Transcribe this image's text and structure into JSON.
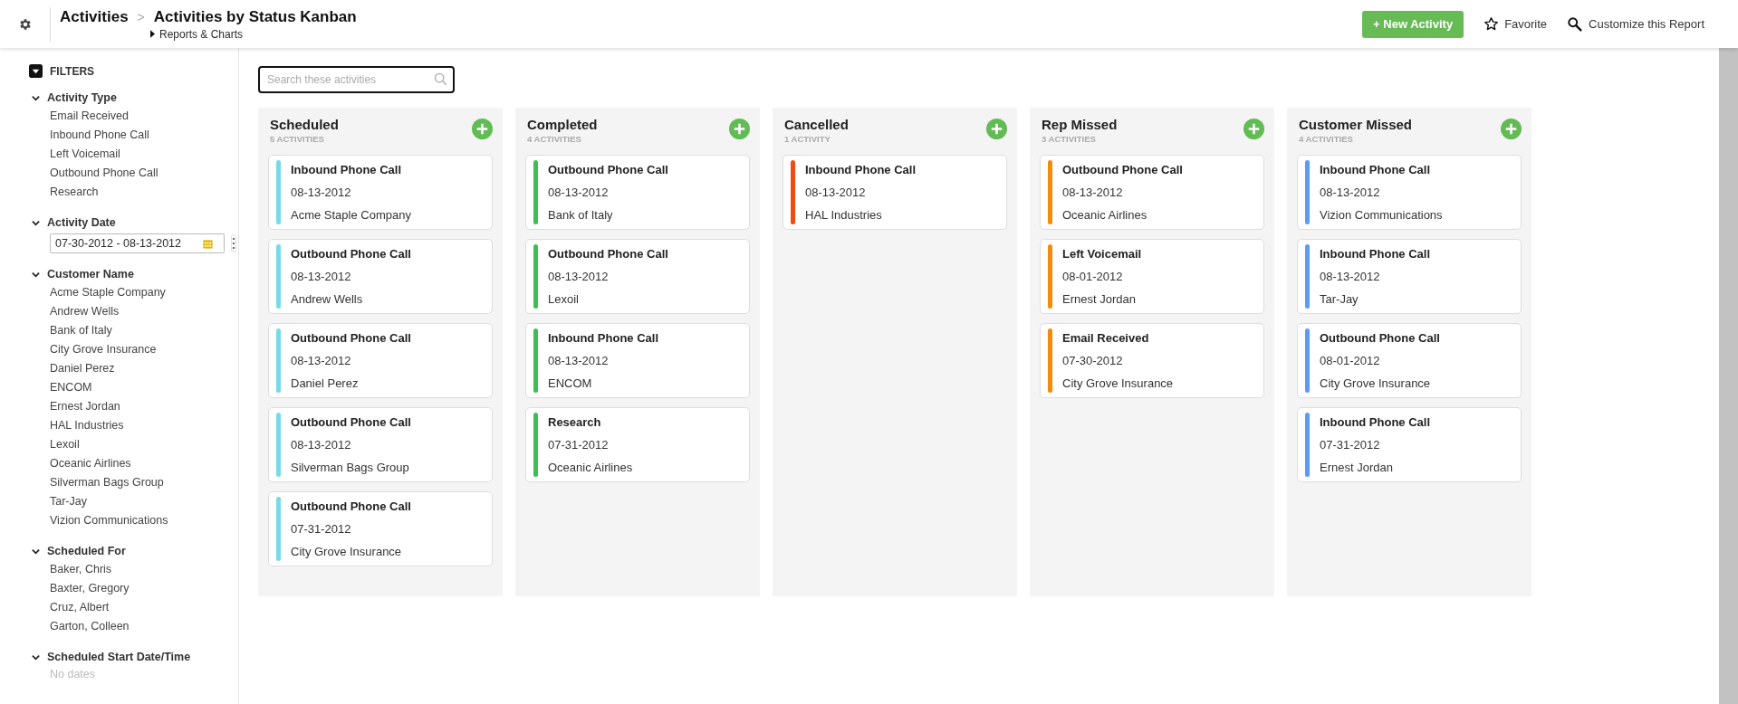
{
  "header": {
    "breadcrumb_root": "Activities",
    "separator": ">",
    "title": "Activities by Status Kanban",
    "subtitle": "Reports & Charts",
    "new_button": "+ New Activity",
    "favorite": "Favorite",
    "customize": "Customize this Report"
  },
  "filters": {
    "title": "FILTERS",
    "sections": [
      {
        "kind": "list",
        "label": "Activity Type",
        "expanded": true,
        "items": [
          "Email Received",
          "Inbound Phone Call",
          "Left Voicemail",
          "Outbound Phone Call",
          "Research"
        ]
      },
      {
        "kind": "daterange",
        "label": "Activity Date",
        "expanded": true,
        "value": "07-30-2012 - 08-13-2012"
      },
      {
        "kind": "list",
        "label": "Customer Name",
        "expanded": true,
        "items": [
          "Acme Staple Company",
          "Andrew Wells",
          "Bank of Italy",
          "City Grove Insurance",
          "Daniel Perez",
          "ENCOM",
          "Ernest Jordan",
          "HAL Industries",
          "Lexoil",
          "Oceanic Airlines",
          "Silverman Bags Group",
          "Tar-Jay",
          "Vizion Communications"
        ]
      },
      {
        "kind": "list",
        "label": "Scheduled For",
        "expanded": true,
        "items": [
          "Baker, Chris",
          "Baxter, Gregory",
          "Cruz, Albert",
          "Garton, Colleen"
        ]
      },
      {
        "kind": "empty",
        "label": "Scheduled Start Date/Time",
        "expanded": true,
        "note": "No dates"
      }
    ]
  },
  "search": {
    "placeholder": "Search these activities"
  },
  "columns": [
    {
      "title": "Scheduled",
      "count": "5 ACTIVITIES",
      "color": "#76dbe8",
      "cards": [
        {
          "type": "Inbound Phone Call",
          "date": "08-13-2012",
          "customer": "Acme Staple Company"
        },
        {
          "type": "Outbound Phone Call",
          "date": "08-13-2012",
          "customer": "Andrew Wells"
        },
        {
          "type": "Outbound Phone Call",
          "date": "08-13-2012",
          "customer": "Daniel Perez"
        },
        {
          "type": "Outbound Phone Call",
          "date": "08-13-2012",
          "customer": "Silverman Bags Group"
        },
        {
          "type": "Outbound Phone Call",
          "date": "07-31-2012",
          "customer": "City Grove Insurance"
        }
      ]
    },
    {
      "title": "Completed",
      "count": "4 ACTIVITIES",
      "color": "#3dbf55",
      "cards": [
        {
          "type": "Outbound Phone Call",
          "date": "08-13-2012",
          "customer": "Bank of Italy"
        },
        {
          "type": "Outbound Phone Call",
          "date": "08-13-2012",
          "customer": "Lexoil"
        },
        {
          "type": "Inbound Phone Call",
          "date": "08-13-2012",
          "customer": "ENCOM"
        },
        {
          "type": "Research",
          "date": "07-31-2012",
          "customer": "Oceanic Airlines"
        }
      ]
    },
    {
      "title": "Cancelled",
      "count": "1 ACTIVITY",
      "color": "#f24b12",
      "cards": [
        {
          "type": "Inbound Phone Call",
          "date": "08-13-2012",
          "customer": "HAL Industries"
        }
      ]
    },
    {
      "title": "Rep Missed",
      "count": "3 ACTIVITIES",
      "color": "#f28c0f",
      "cards": [
        {
          "type": "Outbound Phone Call",
          "date": "08-13-2012",
          "customer": "Oceanic Airlines"
        },
        {
          "type": "Left Voicemail",
          "date": "08-01-2012",
          "customer": "Ernest Jordan"
        },
        {
          "type": "Email Received",
          "date": "07-30-2012",
          "customer": "City Grove Insurance"
        }
      ]
    },
    {
      "title": "Customer Missed",
      "count": "4 ACTIVITIES",
      "color": "#5b9bf5",
      "cards": [
        {
          "type": "Inbound Phone Call",
          "date": "08-13-2012",
          "customer": "Vizion Communications"
        },
        {
          "type": "Inbound Phone Call",
          "date": "08-13-2012",
          "customer": "Tar-Jay"
        },
        {
          "type": "Outbound Phone Call",
          "date": "08-01-2012",
          "customer": "City Grove Insurance"
        },
        {
          "type": "Inbound Phone Call",
          "date": "07-31-2012",
          "customer": "Ernest Jordan"
        }
      ]
    }
  ]
}
